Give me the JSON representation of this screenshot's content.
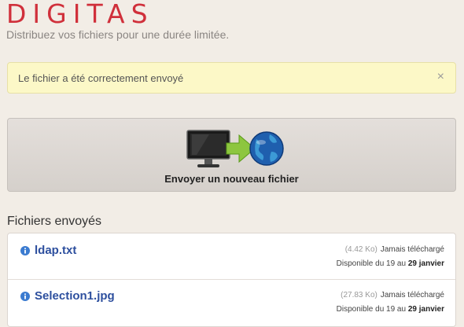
{
  "header": {
    "logo": "DIGITAS",
    "tagline": "Distribuez vos fichiers pour une durée limitée."
  },
  "alert": {
    "message": "Le fichier a été correctement envoyé",
    "close": "×"
  },
  "upload": {
    "label": "Envoyer un nouveau fichier",
    "icons": [
      "monitor-icon",
      "arrow-right-icon",
      "globe-icon"
    ]
  },
  "files_section": {
    "title": "Fichiers envoyés",
    "files": [
      {
        "name": "ldap.txt",
        "size": "(4.42 Ko)",
        "status": "Jamais téléchargé",
        "avail_prefix": "Disponible du 19 au",
        "avail_end": "29 janvier"
      },
      {
        "name": "Selection1.jpg",
        "size": "(27.83 Ko)",
        "status": "Jamais téléchargé",
        "avail_prefix": "Disponible du 19 au",
        "avail_end": "29 janvier"
      }
    ]
  },
  "colors": {
    "brand": "#d0303b",
    "link": "#2d4f9e",
    "alert_bg": "#fcf8c7"
  }
}
